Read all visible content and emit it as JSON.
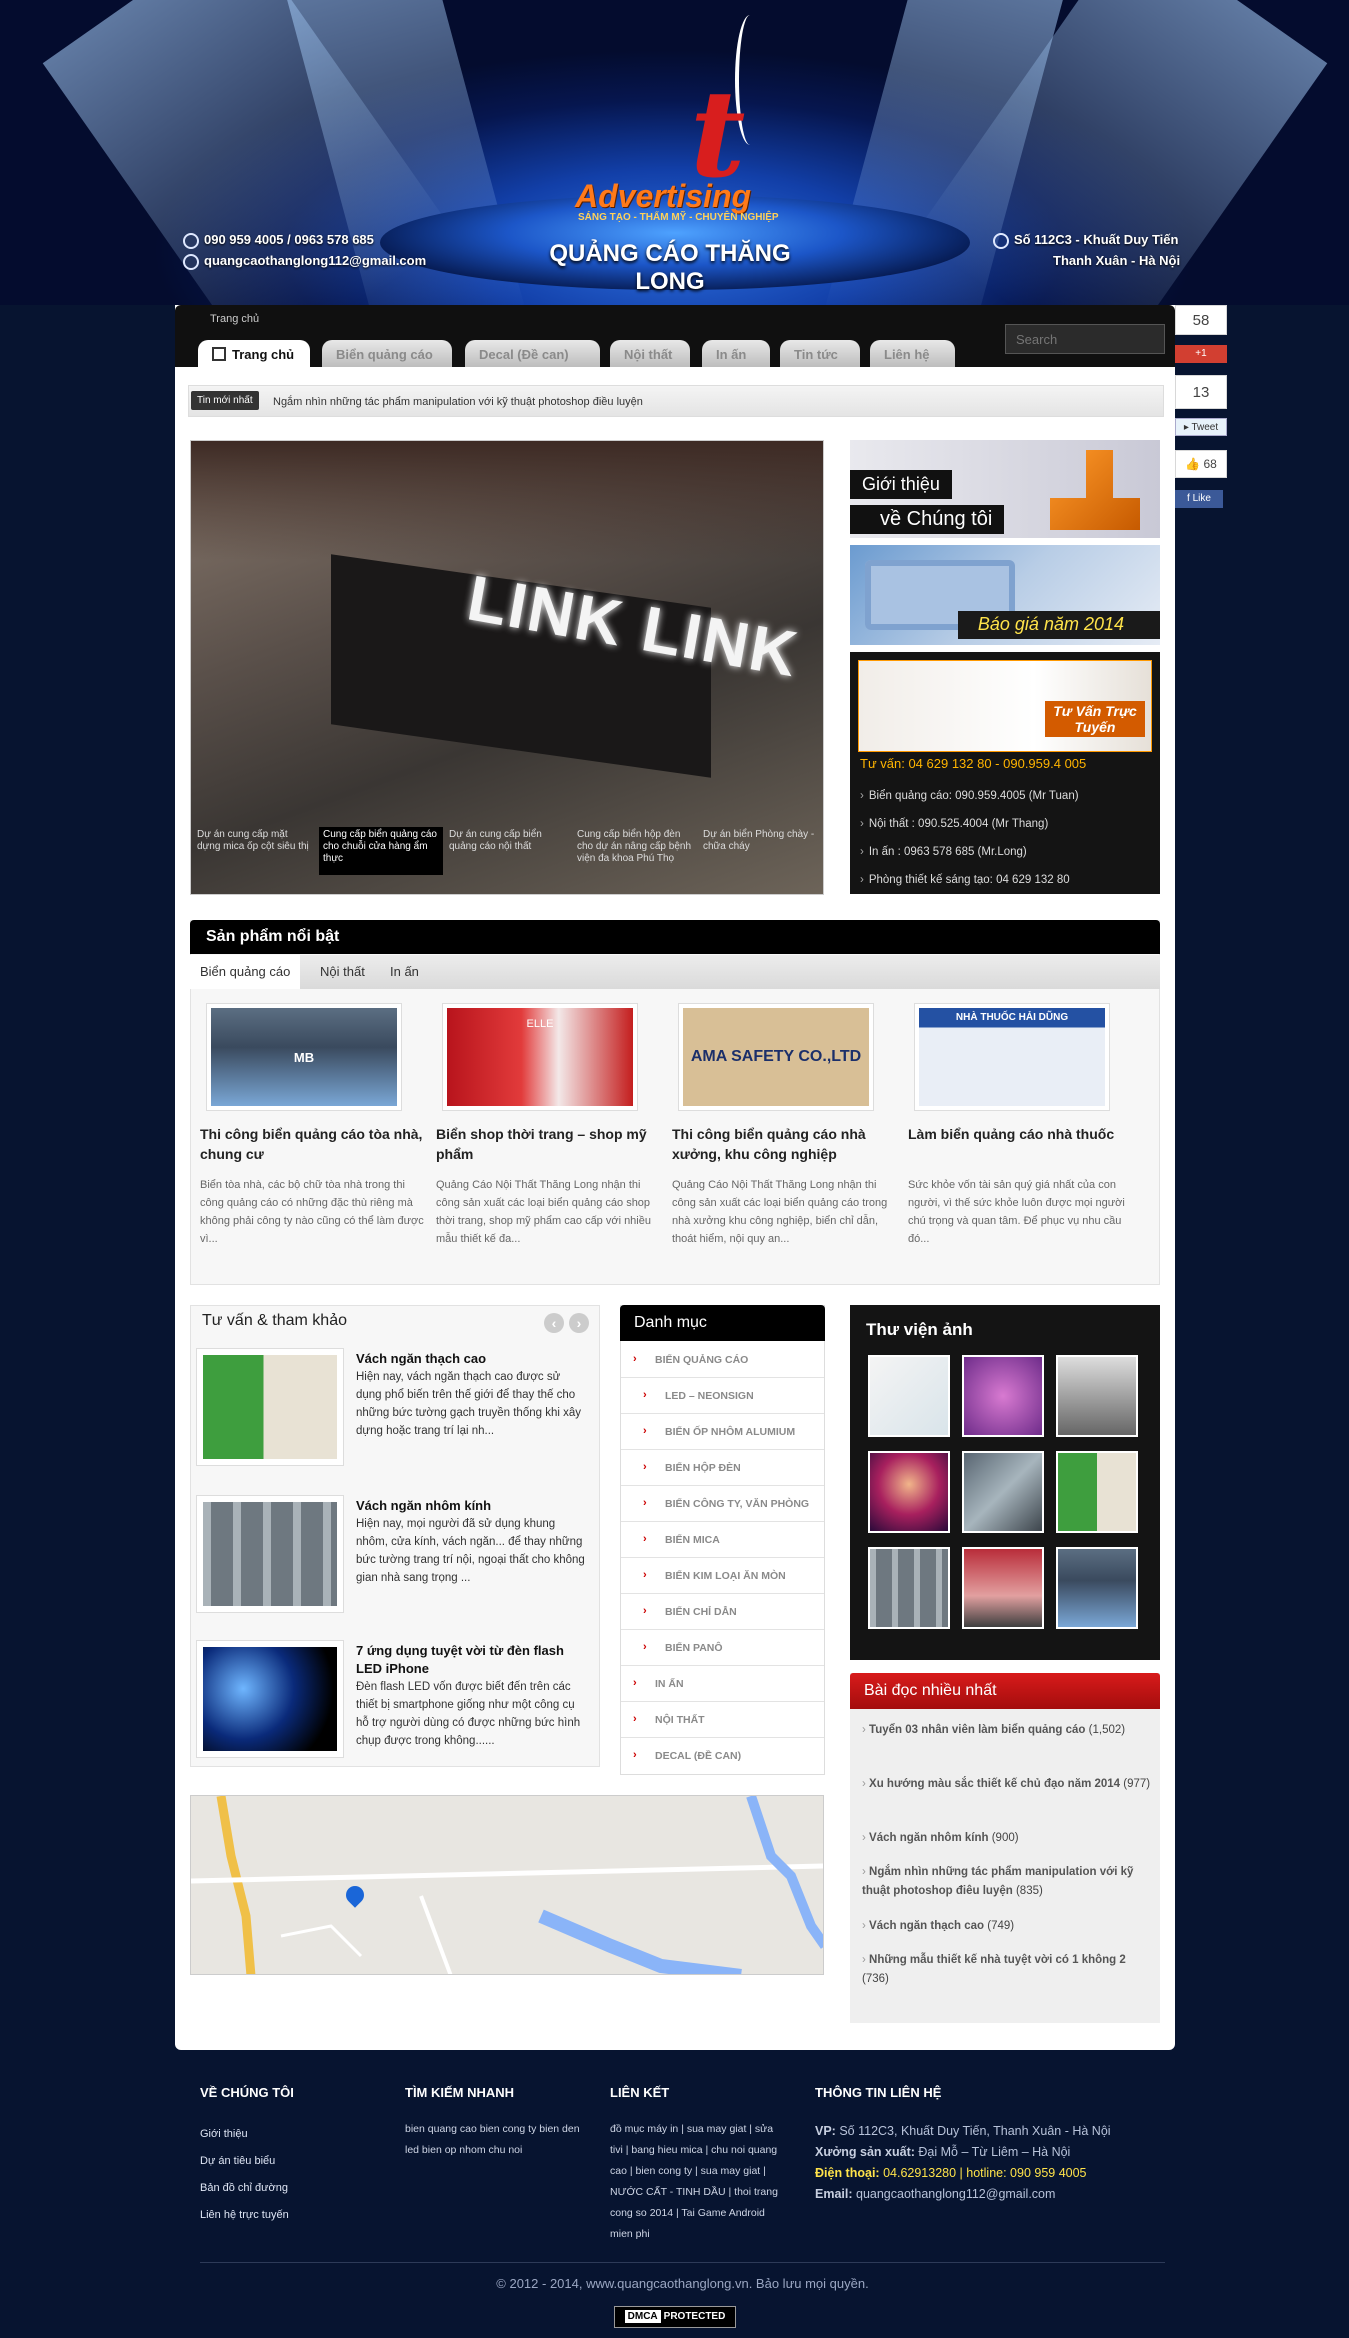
{
  "header": {
    "phone": "090 959 4005 / 0963 578 685",
    "email": "quangcaothanglong112@gmail.com",
    "address_line1": "Số 112C3 - Khuất Duy Tiến",
    "address_line2": "Thanh Xuân - Hà Nội",
    "logo_word": "Advertising",
    "logo_tagline": "SÁNG TẠO - THẨM MỸ - CHUYÊN NGHIỆP",
    "logo_name": "QUẢNG CÁO THĂNG LONG"
  },
  "breadcrumb": "Trang chủ",
  "nav": {
    "tabs": [
      "Trang chủ",
      "Biển quảng cáo",
      "Decal (Đề can)",
      "Nội thất",
      "In ấn",
      "Tin tức",
      "Liên hệ"
    ],
    "search_placeholder": "Search"
  },
  "news": {
    "label": "Tin mới nhất",
    "text": "Ngắm nhìn những tác phẩm manipulation với kỹ thuật photoshop điều luyện"
  },
  "slider": {
    "sign_text": "LINK LINK",
    "captions": [
      "Dự án cung cấp mặt dựng mica ốp cột siêu thị",
      "Cung cấp biển quảng cáo cho chuỗi cửa hàng ẩm thực",
      "Dự án cung cấp biển quảng cáo nội thất",
      "Cung cấp biển hộp đèn cho dự án nâng cấp bệnh viện đa khoa Phú Thọ",
      "Dự án biển Phòng chày - chữa cháy"
    ]
  },
  "side": {
    "about_1": "Giới thiệu",
    "about_2": "về Chúng tôi",
    "price": "Báo giá năm 2014",
    "consult_badge": "Tư Vấn Trực Tuyến",
    "consult_phone": "Tư vấn: 04 629 132 80 - 090.959.4 005",
    "contacts": [
      "Biển quảng cáo: 090.959.4005 (Mr Tuan)",
      "Nội thất : 090.525.4004 (Mr Thang)",
      "In ấn : 0963 578 685 (Mr.Long)",
      "Phòng thiết kế sáng tạo: 04 629 132 80"
    ]
  },
  "featured": {
    "title": "Sản phẩm nổi bật",
    "tabs": [
      "Biển quảng cáo",
      "Nội thất",
      "In ấn"
    ],
    "items": [
      {
        "title": "Thi công biển quảng cáo tòa nhà, chung cư",
        "desc": "Biển tòa nhà, các bộ chữ tòa nhà trong thi công quảng cáo có những đặc thù riêng mà không phải công ty nào cũng có thể làm được vì..."
      },
      {
        "title": "Biển shop thời trang – shop mỹ phẩm",
        "desc": "Quảng Cáo Nội Thất Thăng Long nhận thi công sản xuất các loại biển quảng cáo shop thời trang, shop mỹ phẩm cao cấp với nhiều mẫu thiết kế đa..."
      },
      {
        "title": "Thi công biển quảng cáo nhà xưởng, khu công nghiệp",
        "desc": "Quảng Cáo Nội Thất Thăng Long nhận thi công sản xuất các loại biển quảng cáo trong nhà xưởng khu công nghiệp, biển chỉ dẫn, thoát hiểm, nội quy an..."
      },
      {
        "title": "Làm biển quảng cáo nhà thuốc",
        "desc": "Sức khỏe vốn tài sản quý giá nhất của con người, vì thế sức khỏe luôn được mọi người chú trọng và quan tâm. Để phục vụ nhu cầu đó..."
      }
    ],
    "img_texts": [
      "MB",
      "ELLE",
      "AMA SAFETY CO.,LTD",
      "NHÀ THUỐC HẢI DŨNG"
    ]
  },
  "advice": {
    "title": "Tư vấn & tham khảo",
    "items": [
      {
        "title": "Vách ngăn thạch cao",
        "desc": "Hiện nay, vách ngăn thạch cao được sử dụng phổ biến trên thế giới để thay thế cho những bức tường gạch truyền thống khi xây dựng hoặc trang trí lại nh..."
      },
      {
        "title": "Vách ngăn nhôm kính",
        "desc": "Hiện nay, mọi người đã sử dụng khung nhôm, cửa kính, vách ngăn... để thay những bức tường trang trí nội, ngoại thất cho không gian nhà sang trọng ..."
      },
      {
        "title": "7 ứng dụng tuyệt vời từ đèn flash LED iPhone",
        "desc": "Đèn flash LED vốn được biết đến trên các thiết bị smartphone giống như một công cụ hỗ trợ người dùng có được những bức hình chụp được trong không......"
      }
    ]
  },
  "categories": {
    "title": "Danh mục",
    "items": [
      {
        "label": "BIỂN QUẢNG CÁO",
        "sub": false
      },
      {
        "label": "LED – NEONSIGN",
        "sub": true
      },
      {
        "label": "BIỂN ỐP NHÔM ALUMIUM",
        "sub": true
      },
      {
        "label": "BIỂN HỘP ĐÈN",
        "sub": true
      },
      {
        "label": "BIỂN CÔNG TY, VĂN PHÒNG",
        "sub": true
      },
      {
        "label": "BIỂN MICA",
        "sub": true
      },
      {
        "label": "BIỂN KIM LOẠI ĂN MÒN",
        "sub": true
      },
      {
        "label": "BIỂN CHỈ DẪN",
        "sub": true
      },
      {
        "label": "BIỂN PANÔ",
        "sub": true
      },
      {
        "label": "IN ẤN",
        "sub": false
      },
      {
        "label": "NỘI THẤT",
        "sub": false
      },
      {
        "label": "DECAL (ĐỀ CAN)",
        "sub": false
      }
    ]
  },
  "gallery": {
    "title": "Thư viện ảnh"
  },
  "popular": {
    "title": "Bài đọc nhiều nhất",
    "items": [
      {
        "text": "Tuyển 03 nhân viên làm biển quảng cáo",
        "count": "(1,502)"
      },
      {
        "text": "Xu hướng màu sắc thiết kế chủ đạo năm 2014",
        "count": "(977)"
      },
      {
        "text": "Vách ngăn nhôm kính",
        "count": "(900)"
      },
      {
        "text": "Ngắm nhìn những tác phẩm manipulation với kỹ thuật photoshop điêu luyện",
        "count": "(835)"
      },
      {
        "text": "Vách ngăn thạch cao",
        "count": "(749)"
      },
      {
        "text": "Những mẫu thiết kế nhà tuyệt vời có 1 không 2",
        "count": "(736)"
      }
    ]
  },
  "footer": {
    "col1_title": "VỀ CHÚNG TÔI",
    "col1_links": [
      "Giới thiệu",
      "Dự án tiêu biểu",
      "Bản đồ chỉ đường",
      "Liên hệ trực tuyến"
    ],
    "col2_title": "TÌM KIẾM NHANH",
    "col2_text": "bien quang cao bien cong ty bien den led bien op nhom chu noi",
    "col3_title": "LIÊN KẾT",
    "col3_lines": [
      "đồ mục máy in | sua may giat | sửa",
      "tivi | bang hieu mica | chu noi quang",
      "cao | bien cong ty | sua may giat |",
      "NƯỚC CẤT - TINH DẦU | thoi trang",
      "cong so 2014 | Tai Game Android",
      "mien phi"
    ],
    "col4_title": "THÔNG TIN LIÊN HỆ",
    "vp_label": "VP:",
    "vp": "Số 112C3, Khuất Duy Tiến, Thanh Xuân - Hà Nội",
    "xuong_label": "Xưởng sản xuất:",
    "xuong": "Đại Mỗ – Từ Liêm – Hà Nội",
    "phone_label": "Điện thoại:",
    "phone": "04.62913280 | hotline: 090 959 4005",
    "email_label": "Email:",
    "email": "quangcaothanglong112@gmail.com",
    "copyright": "© 2012 - 2014, www.quangcaothanglong.vn. Bảo lưu mọi quyền.",
    "dmca_1": "DMCA",
    "dmca_2": "PROTECTED"
  },
  "social": {
    "gplus_count": "58",
    "gplus_label": "+1",
    "tweet_count": "13",
    "tweet_label": "Tweet",
    "like_count": "68",
    "like_label": "Like"
  }
}
